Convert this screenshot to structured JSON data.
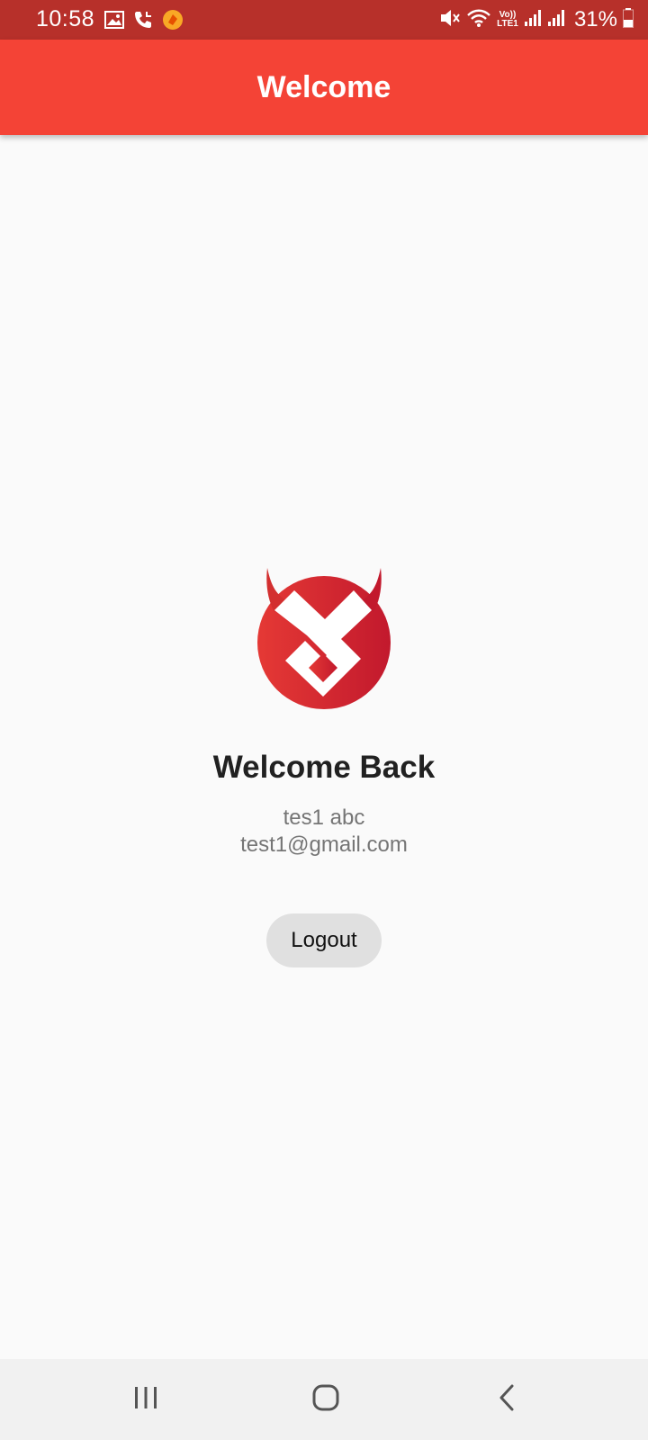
{
  "status_bar": {
    "time": "10:58",
    "battery": "31%",
    "network_label": "Vo)) LTE1",
    "icons": [
      "gallery-icon",
      "call-icon",
      "app-notification-icon",
      "mute-icon",
      "wifi-icon",
      "lte-icon",
      "signal-icon",
      "signal-icon",
      "battery-icon"
    ]
  },
  "app_bar": {
    "title": "Welcome",
    "color": "#f44336"
  },
  "main": {
    "logo_icon": "brand-logo-icon",
    "heading": "Welcome Back",
    "user_name": "tes1 abc",
    "user_email": "test1@gmail.com",
    "logout_label": "Logout"
  },
  "nav_bar": {
    "icons": [
      "recent-apps-icon",
      "home-icon",
      "back-icon"
    ]
  },
  "colors": {
    "status_bar": "#b7302a",
    "app_bar": "#f44336",
    "logo_red": "#d32f2f",
    "background": "#fafafa"
  }
}
